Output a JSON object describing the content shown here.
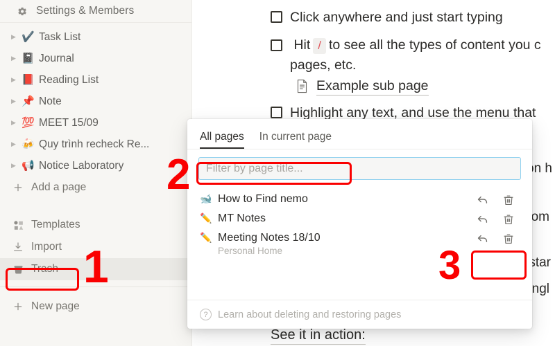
{
  "sidebar": {
    "header": {
      "label": "Settings & Members",
      "icon": "gear-icon"
    },
    "pages": [
      {
        "emoji": "✔️",
        "label": "Task List"
      },
      {
        "emoji": "📓",
        "label": "Journal"
      },
      {
        "emoji": "📕",
        "label": "Reading List"
      },
      {
        "emoji": "📌",
        "label": "Note"
      },
      {
        "emoji": "💯",
        "label": "MEET 15/09"
      },
      {
        "emoji": "🍻",
        "label": "Quy trình recheck Re..."
      },
      {
        "emoji": "📢",
        "label": "Notice Laboratory"
      }
    ],
    "add_page": {
      "label": "Add a page",
      "icon": "plus-icon"
    },
    "tools": [
      {
        "label": "Templates",
        "icon": "templates-icon"
      },
      {
        "label": "Import",
        "icon": "import-icon"
      },
      {
        "label": "Trash",
        "icon": "trash-icon"
      }
    ],
    "new_page": {
      "label": "New page",
      "icon": "plus-icon"
    }
  },
  "document": {
    "todos": [
      {
        "text": "Click anywhere and just start typing"
      },
      {
        "text_before": "Hit",
        "key": "/",
        "text_after": "to see all the types of content you c",
        "text_wrap": "pages, etc."
      },
      {
        "text": "Highlight any text, and use the menu that"
      }
    ],
    "sub_page": {
      "label": "Example sub page",
      "icon": "page-icon"
    },
    "bottom_heading": "See it in action:",
    "right_fragments": [
      "on h",
      "tom",
      "star",
      "ngl"
    ]
  },
  "popup": {
    "tabs": [
      {
        "label": "All pages",
        "active": true
      },
      {
        "label": "In current page",
        "active": false
      }
    ],
    "filter": {
      "value": "",
      "placeholder": "Filter by page title..."
    },
    "results": [
      {
        "emoji": "🐋",
        "title": "How to Find nemo",
        "subtitle": "",
        "restore_icon": "restore-arrow-icon",
        "delete_icon": "trash-icon"
      },
      {
        "emoji": "✏️",
        "title": "MT Notes",
        "subtitle": "",
        "restore_icon": "restore-arrow-icon",
        "delete_icon": "trash-icon"
      },
      {
        "emoji": "✏️",
        "title": "Meeting Notes 18/10",
        "subtitle": "Personal Home",
        "restore_icon": "restore-arrow-icon",
        "delete_icon": "trash-icon"
      }
    ],
    "footer": {
      "label": "Learn about deleting and restoring pages",
      "icon": "question-circle-icon"
    }
  },
  "annotations": {
    "color": "#fa0000",
    "markers": [
      {
        "number": "1"
      },
      {
        "number": "2"
      },
      {
        "number": "3"
      }
    ]
  }
}
